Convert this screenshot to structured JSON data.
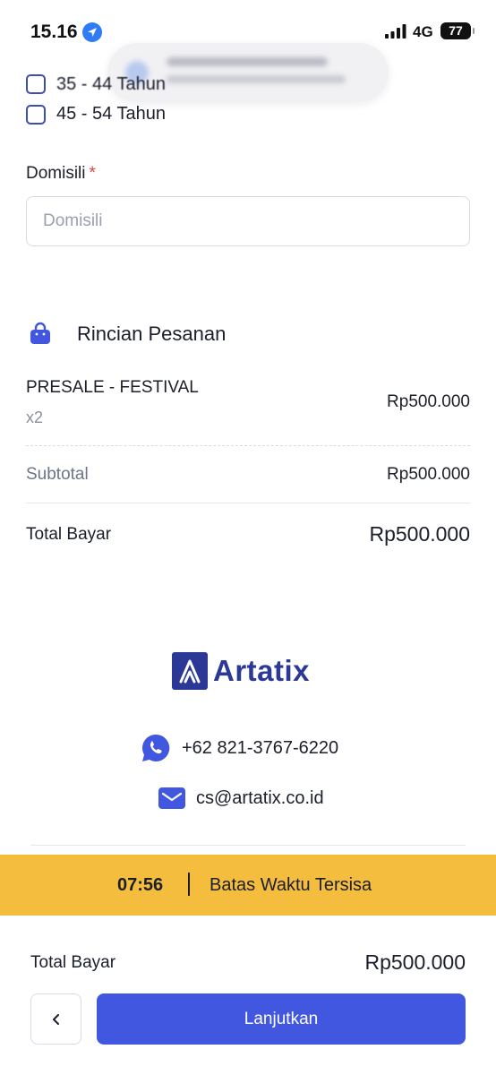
{
  "status_bar": {
    "time": "15.16",
    "network": "4G",
    "battery": "77"
  },
  "form": {
    "age_options": [
      {
        "label": "35 - 44 Tahun",
        "checked": false
      },
      {
        "label": "45 - 54 Tahun",
        "checked": false
      }
    ],
    "domisili": {
      "label": "Domisili",
      "required_mark": "*",
      "placeholder": "Domisili",
      "value": ""
    }
  },
  "order": {
    "title": "Rincian Pesanan",
    "item": {
      "name": "PRESALE - FESTIVAL",
      "qty": "x2",
      "price": "Rp500.000"
    },
    "subtotal_label": "Subtotal",
    "subtotal_value": "Rp500.000",
    "total_label": "Total Bayar",
    "total_value": "Rp500.000"
  },
  "footer": {
    "brand": "Artatix",
    "phone": "+62 821-3767-6220",
    "email": "cs@artatix.co.id",
    "icons": {
      "phone": "whatsapp-icon",
      "email": "mail-icon"
    }
  },
  "timer": {
    "value": "07:56",
    "label": "Batas Waktu Tersisa"
  },
  "bottom_bar": {
    "total_label": "Total Bayar",
    "total_value": "Rp500.000",
    "back_icon": "chevron-left-icon",
    "continue_label": "Lanjutkan"
  },
  "colors": {
    "primary": "#4257e0",
    "brand": "#2b3895",
    "timer_banner": "#f4bd3d",
    "required": "#e0443b"
  }
}
